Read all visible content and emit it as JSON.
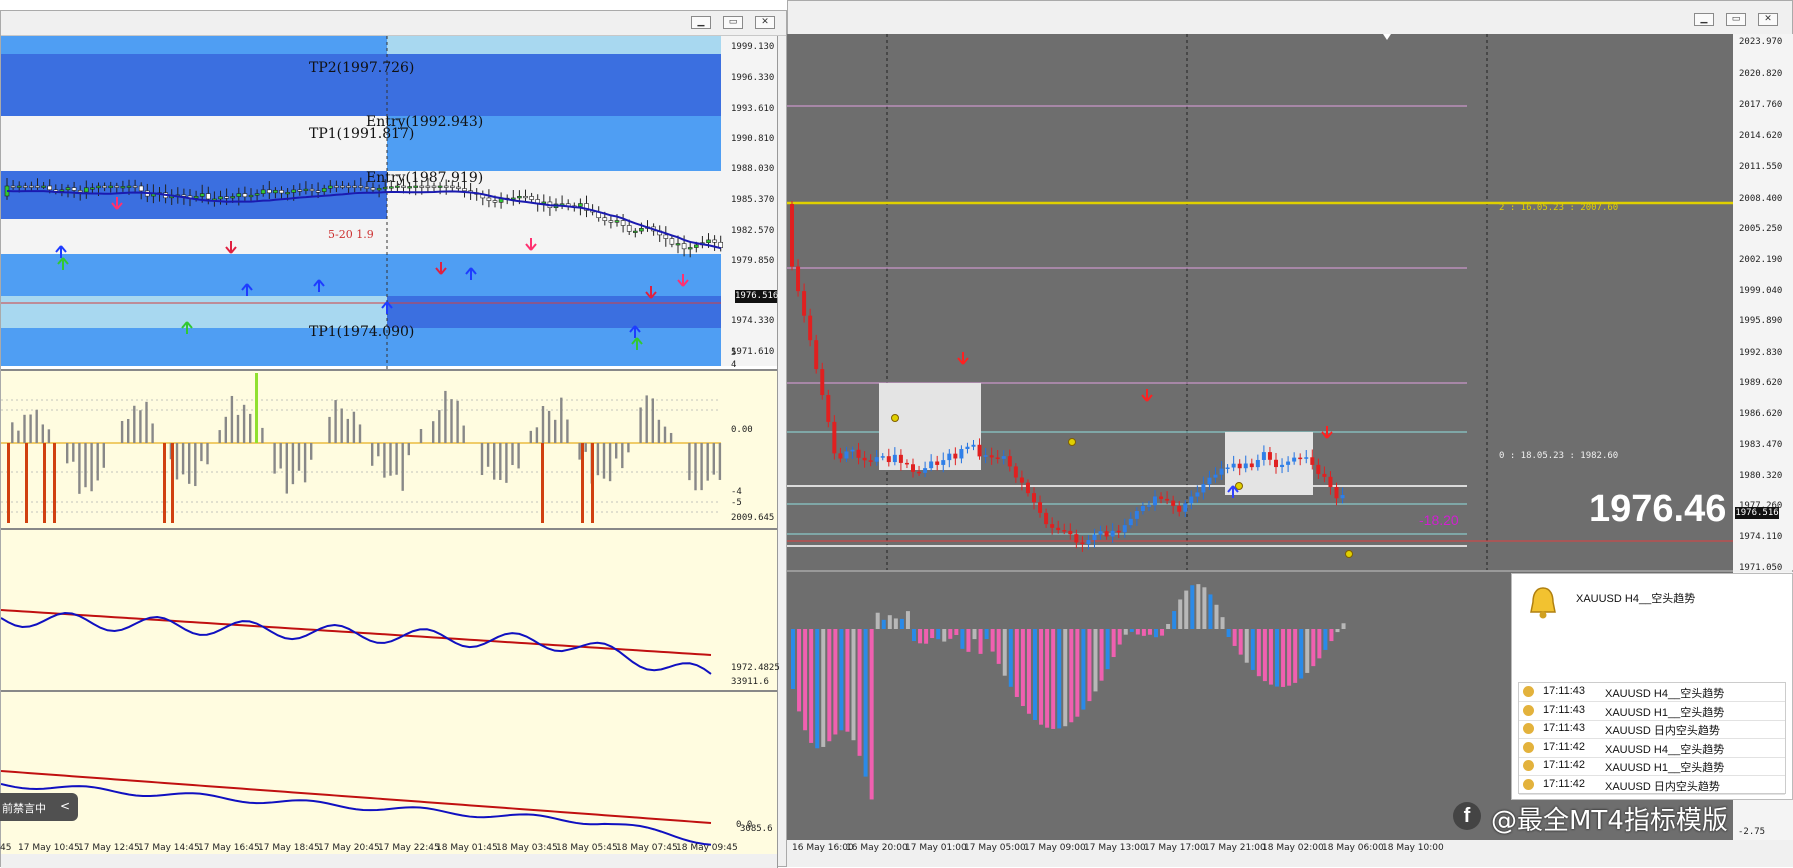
{
  "left_window": {
    "price_labels": [
      "1999.130",
      "1996.330",
      "1993.610",
      "1990.810",
      "1988.030",
      "1985.370",
      "1982.570",
      "1979.850",
      "1976.516",
      "1974.330",
      "1971.610"
    ],
    "current_price": "1976.516",
    "level_labels": {
      "tp2": "TP2(1997.726)",
      "entry1": "Entry(1992.943)",
      "tp1_top": "TP1(1991.817)",
      "entry2": "Entry(1987.919)",
      "tp1_bottom": "TP1(1974.090)",
      "mid_note": "5-20 1.9"
    },
    "osc_labels": [
      "5",
      "4",
      "0.00",
      "-4",
      "-5"
    ],
    "ind2_labels": [
      "2009.645",
      "1972.4825"
    ],
    "ind3_labels": [
      "33911.6",
      "0.0",
      "3085.6"
    ],
    "time_labels": [
      "45",
      "17 May 10:45",
      "17 May 12:45",
      "17 May 14:45",
      "17 May 16:45",
      "17 May 18:45",
      "17 May 20:45",
      "17 May 22:45",
      "18 May 01:45",
      "18 May 03:45",
      "18 May 05:45",
      "18 May 07:45",
      "18 May 09:45"
    ],
    "toast": {
      "text": "前禁言中",
      "chevron": "<"
    }
  },
  "right_window": {
    "price_labels": [
      "2023.970",
      "2020.820",
      "2017.760",
      "2014.620",
      "2011.550",
      "2008.400",
      "2005.250",
      "2002.190",
      "1999.040",
      "1995.890",
      "1992.830",
      "1989.620",
      "1986.620",
      "1983.470",
      "1980.320",
      "1977.260",
      "1974.110",
      "1971.050"
    ],
    "current_price": "1976.516",
    "big_price": "1976.46",
    "profit": "-18.20",
    "fib_labels": {
      "top": "2 : 16.05.23 : 2007.60",
      "mid": "0 : 18.05.23 : 1982.60"
    },
    "time_labels": [
      "16 May 16:00",
      "16 May 20:00",
      "17 May 01:00",
      "17 May 05:00",
      "17 May 09:00",
      "17 May 13:00",
      "17 May 17:00",
      "17 May 21:00",
      "18 May 02:00",
      "18 May 06:00",
      "18 May 10:00"
    ],
    "osc_bottom_label": "-2.75"
  },
  "alert_panel": {
    "title": "XAUUSD  H4__空头趋势",
    "rows": [
      {
        "time": "17:11:43",
        "message": "XAUUSD  H4__空头趋势"
      },
      {
        "time": "17:11:43",
        "message": "XAUUSD  H1__空头趋势"
      },
      {
        "time": "17:11:43",
        "message": "XAUUSD  日内空头趋势"
      },
      {
        "time": "17:11:42",
        "message": "XAUUSD  H4__空头趋势"
      },
      {
        "time": "17:11:42",
        "message": "XAUUSD  H1__空头趋势"
      },
      {
        "time": "17:11:42",
        "message": "XAUUSD  日内空头趋势"
      }
    ]
  },
  "watermark": {
    "text": "@最全MT4指标模版"
  },
  "colors": {
    "blue_band": "#3b6fe0",
    "light_blue": "#4f9ef3",
    "pale_blue": "#a8d8f0",
    "osc_bg": "#fffce0",
    "chart_bg": "#6e6e6e",
    "bull": "#32c832",
    "bear": "#e02020",
    "gold": "#e0d000"
  }
}
